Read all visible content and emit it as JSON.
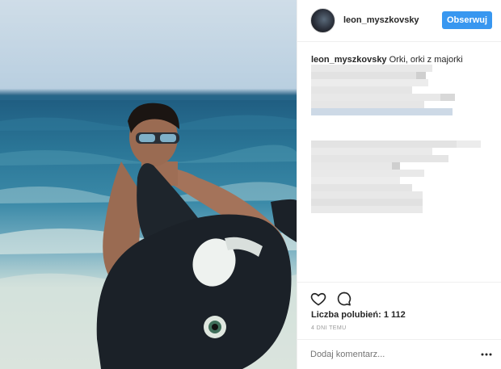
{
  "post": {
    "username": "leon_myszkovsky",
    "follow_label": "Obserwuj",
    "caption_text": "Orki, orki z majorki",
    "likes_label": "Liczba polubień: 1 112",
    "time_label": "4 DNI TEMU",
    "comment_placeholder": "Dodaj komentarz..."
  },
  "icons": {
    "like": "heart-outline-icon",
    "comment": "speech-bubble-icon",
    "more": "more-options-icon"
  },
  "colors": {
    "follow_button": "#3897f0",
    "muted_text": "#999999",
    "divider": "#efefef"
  }
}
